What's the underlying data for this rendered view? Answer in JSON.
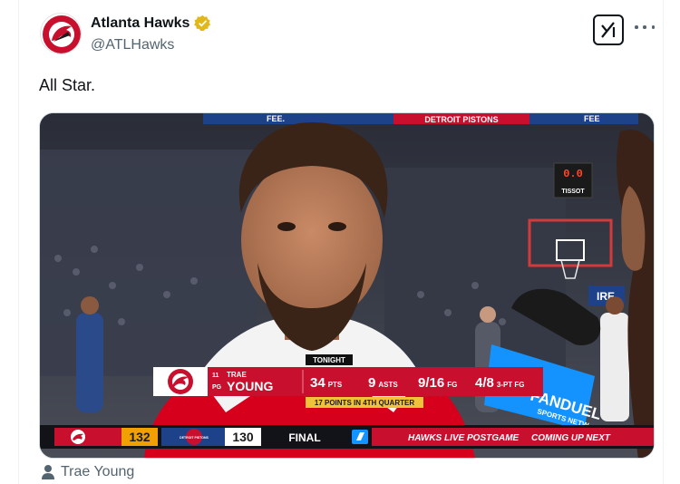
{
  "tweet": {
    "display_name": "Atlanta Hawks",
    "handle": "@ATLHawks",
    "text": "All Star.",
    "tagged_user": "Trae Young",
    "icons": {
      "avatar": "hawks-logo-icon",
      "verified": "verified-badge-icon",
      "grok": "grok-icon",
      "more": "more-icon",
      "tag": "person-icon"
    }
  },
  "media": {
    "arena_banner_left": "FEE.",
    "arena_banner_center": "DETROIT PISTONS",
    "arena_banner_right": "FEE",
    "shot_clock": "0.0",
    "shot_clock_sponsor": "TISSOT",
    "sign_fragment": "IRE",
    "mic_flag": {
      "line1": "FANDUEL",
      "line2": "SPORTS NETW"
    },
    "player_card": {
      "tag": "TONIGHT",
      "number": "11",
      "position": "PG",
      "first_name": "TRAE",
      "last_name": "YOUNG",
      "stats": [
        {
          "value": "34",
          "label": "PTS"
        },
        {
          "value": "9",
          "label": "ASTS"
        },
        {
          "value": "9/16",
          "label": "FG"
        },
        {
          "value": "4/8",
          "label": "3-PT FG"
        }
      ],
      "footnote": "17 POINTS IN 4TH QUARTER"
    },
    "scorebug": {
      "home_score": "132",
      "away_logo_text": "DETROIT PISTONS",
      "away_score": "130",
      "status": "FINAL",
      "network_label": "HAWKS LIVE POSTGAME",
      "coming_up": "COMING UP NEXT"
    }
  },
  "colors": {
    "text_primary": "#0f1419",
    "text_secondary": "#536471",
    "hawks_red": "#c8102e",
    "verified_gold": "#e2b719",
    "pistons_blue": "#1d428a"
  }
}
